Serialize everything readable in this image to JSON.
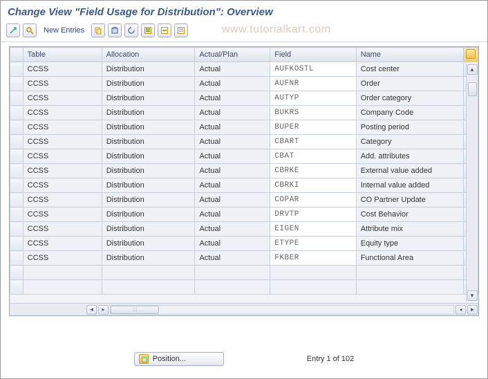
{
  "title": "Change View \"Field Usage for Distribution\": Overview",
  "toolbar": {
    "new_entries": "New Entries"
  },
  "watermark": "www.tutorialkart.com",
  "columns": {
    "table": "Table",
    "allocation": "Allocation",
    "actual_plan": "Actual/Plan",
    "field": "Field",
    "name": "Name"
  },
  "rows": [
    {
      "table": "CCSS",
      "allocation": "Distribution",
      "ap": "Actual",
      "field": "AUFKOSTL",
      "name": "Cost center"
    },
    {
      "table": "CCSS",
      "allocation": "Distribution",
      "ap": "Actual",
      "field": "AUFNR",
      "name": "Order"
    },
    {
      "table": "CCSS",
      "allocation": "Distribution",
      "ap": "Actual",
      "field": "AUTYP",
      "name": "Order category"
    },
    {
      "table": "CCSS",
      "allocation": "Distribution",
      "ap": "Actual",
      "field": "BUKRS",
      "name": "Company Code"
    },
    {
      "table": "CCSS",
      "allocation": "Distribution",
      "ap": "Actual",
      "field": "BUPER",
      "name": "Posting period"
    },
    {
      "table": "CCSS",
      "allocation": "Distribution",
      "ap": "Actual",
      "field": "CBART",
      "name": "Category"
    },
    {
      "table": "CCSS",
      "allocation": "Distribution",
      "ap": "Actual",
      "field": "CBAT",
      "name": "Add. attributes"
    },
    {
      "table": "CCSS",
      "allocation": "Distribution",
      "ap": "Actual",
      "field": "CBRKE",
      "name": "External value added"
    },
    {
      "table": "CCSS",
      "allocation": "Distribution",
      "ap": "Actual",
      "field": "CBRKI",
      "name": "Internal value added"
    },
    {
      "table": "CCSS",
      "allocation": "Distribution",
      "ap": "Actual",
      "field": "COPAR",
      "name": "CO Partner Update"
    },
    {
      "table": "CCSS",
      "allocation": "Distribution",
      "ap": "Actual",
      "field": "DRVTP",
      "name": "Cost Behavior"
    },
    {
      "table": "CCSS",
      "allocation": "Distribution",
      "ap": "Actual",
      "field": "EIGEN",
      "name": "Attribute mix"
    },
    {
      "table": "CCSS",
      "allocation": "Distribution",
      "ap": "Actual",
      "field": "ETYPE",
      "name": "Equity type"
    },
    {
      "table": "CCSS",
      "allocation": "Distribution",
      "ap": "Actual",
      "field": "FKBER",
      "name": "Functional Area"
    }
  ],
  "footer": {
    "position_btn": "Position...",
    "entry_text": "Entry 1 of 102"
  }
}
